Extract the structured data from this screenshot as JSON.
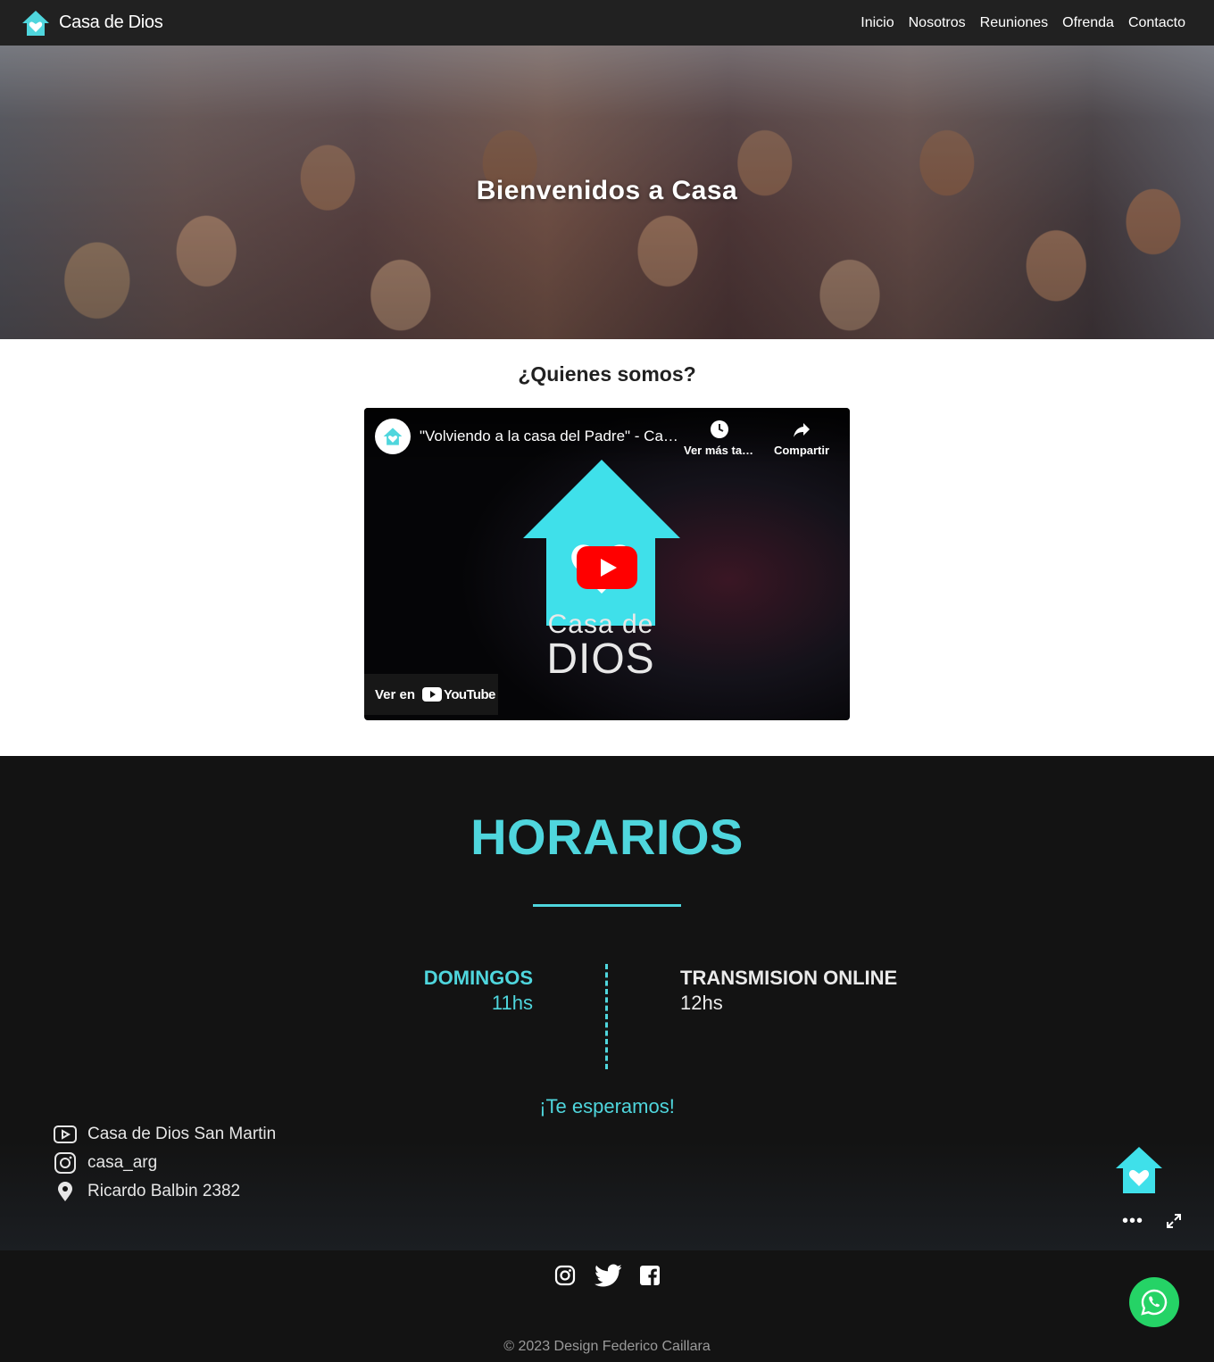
{
  "navbar": {
    "brand": "Casa de Dios",
    "links": [
      "Inicio",
      "Nosotros",
      "Reuniones",
      "Ofrenda",
      "Contacto"
    ]
  },
  "hero": {
    "title": "Bienvenidos a Casa"
  },
  "about": {
    "title": "¿Quienes somos?",
    "video": {
      "title": "\"Volviendo a la casa del Padre\" - Casa de Dios",
      "watch_later": "Ver más tarde",
      "share": "Compartir",
      "brand_line1": "Casa de",
      "brand_line2": "DIOS",
      "watch_on": "Ver en",
      "youtube_word": "YouTube"
    }
  },
  "horarios": {
    "title": "HORARIOS",
    "left": {
      "day": "DOMINGOS",
      "time": "11hs"
    },
    "right": {
      "day": "TRANSMISION ONLINE",
      "time": "12hs"
    },
    "welcome": "¡Te esperamos!"
  },
  "contact": {
    "youtube": "Casa de Dios San Martin",
    "instagram": "casa_arg",
    "address": "Ricardo Balbin 2382"
  },
  "footer": {
    "copyright": "© 2023 Design Federico Caillara"
  },
  "colors": {
    "accent": "#4fd6dd",
    "navbar": "#212121",
    "dark": "#131313",
    "whatsapp": "#25d366",
    "youtube_red": "#ff0000"
  },
  "icons": [
    "house-heart-icon",
    "clock-icon",
    "share-icon",
    "play-icon",
    "youtube-icon",
    "instagram-icon",
    "location-pin-icon",
    "twitter-icon",
    "facebook-icon",
    "whatsapp-icon",
    "more-icon",
    "expand-icon"
  ]
}
